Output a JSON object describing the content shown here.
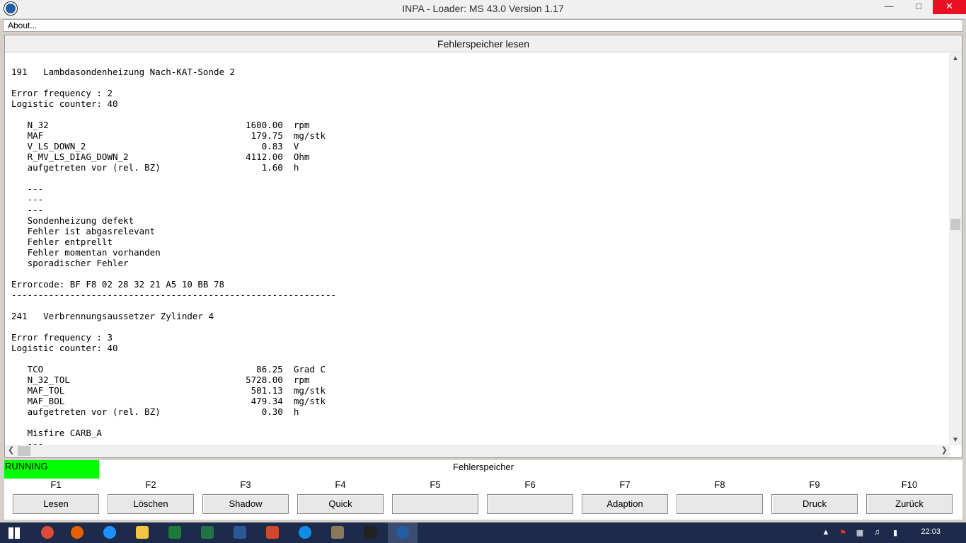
{
  "window": {
    "title": "INPA - Loader:  MS 43.0 Version 1.17"
  },
  "menu": {
    "about": "About..."
  },
  "panel": {
    "title": "Fehlerspeicher lesen",
    "lines": [
      "191   Lambdasondenheizung Nach-KAT-Sonde 2",
      "",
      "Error frequency : 2",
      "Logistic counter: 40",
      "",
      "   N_32                                     1600.00  rpm",
      "   MAF                                       179.75  mg/stk",
      "   V_LS_DOWN_2                                 0.83  V",
      "   R_MV_LS_DIAG_DOWN_2                      4112.00  Ohm",
      "   aufgetreten vor (rel. BZ)                   1.60  h",
      "",
      "   ---",
      "   ---",
      "   ---",
      "   Sondenheizung defekt",
      "   Fehler ist abgasrelevant",
      "   Fehler entprellt",
      "   Fehler momentan vorhanden",
      "   sporadischer Fehler",
      "",
      "Errorcode: BF F8 02 28 32 21 A5 10 BB 78",
      "-------------------------------------------------------------",
      "",
      "241   Verbrennungsaussetzer Zylinder 4",
      "",
      "Error frequency : 3",
      "Logistic counter: 40",
      "",
      "   TCO                                        86.25  Grad C",
      "   N_32_TOL                                 5728.00  rpm",
      "   MAF_TOL                                   501.13  mg/stk",
      "   MAF_BOL                                   479.34  mg/stk",
      "   aufgetreten vor (rel. BZ)                   0.30  h",
      "",
      "   Misfire CARB_A",
      "   ---"
    ]
  },
  "status": {
    "state": "RUNNING",
    "label": "Fehlerspeicher",
    "state_color": "#00ff00"
  },
  "fkeys": [
    {
      "key": "F1",
      "label": "Lesen"
    },
    {
      "key": "F2",
      "label": "Löschen"
    },
    {
      "key": "F3",
      "label": "Shadow"
    },
    {
      "key": "F4",
      "label": "Quick"
    },
    {
      "key": "F5",
      "label": ""
    },
    {
      "key": "F6",
      "label": ""
    },
    {
      "key": "F7",
      "label": "Adaption"
    },
    {
      "key": "F8",
      "label": ""
    },
    {
      "key": "F9",
      "label": "Druck"
    },
    {
      "key": "F10",
      "label": "Zurück"
    }
  ],
  "taskbar": {
    "clock": "22:03",
    "apps": [
      "windows-start-icon",
      "chrome-icon",
      "firefox-icon",
      "ie-icon",
      "explorer-icon",
      "excel-green-icon",
      "excel-icon",
      "word-icon",
      "powerpoint-icon",
      "teamviewer-icon",
      "gimp-icon",
      "terminal-icon",
      "bmw-inpa-icon"
    ],
    "app_colors": [
      "#ffffff",
      "#de4b3a",
      "#e66000",
      "#1e90ff",
      "#f4c542",
      "#1d7a3a",
      "#217346",
      "#2b579a",
      "#d24726",
      "#0e8ee9",
      "#8a7a5a",
      "#222222",
      "#1f5fa8"
    ]
  }
}
